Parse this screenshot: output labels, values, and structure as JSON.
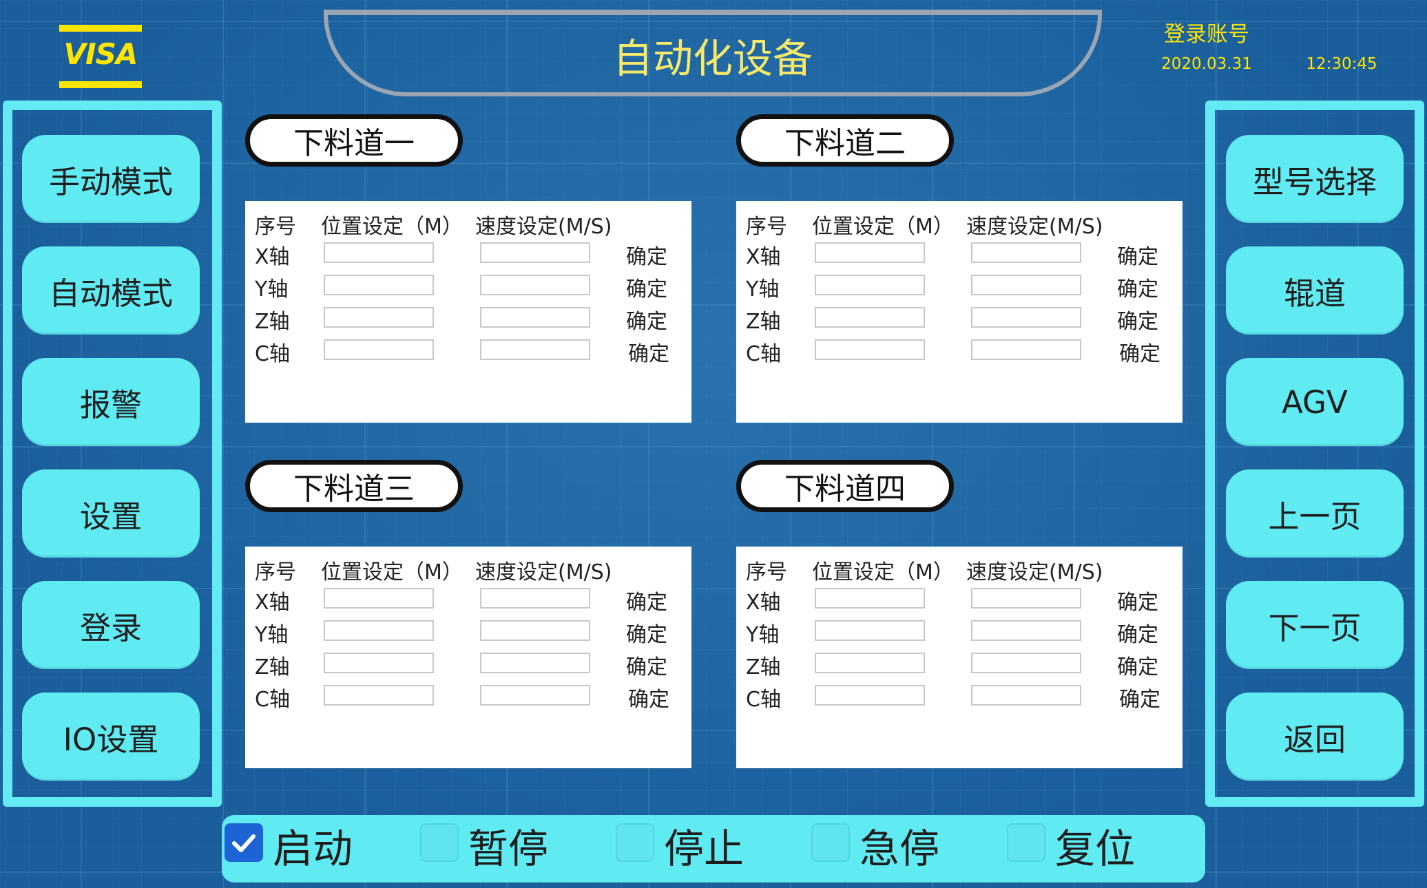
{
  "header": {
    "logo_text": "VISA",
    "title": "自动化设备",
    "account": "登录账号",
    "date": "2020.03.31",
    "time": "12:30:45"
  },
  "left_menu": [
    "手动模式",
    "自动模式",
    "报警",
    "设置",
    "登录",
    "IO设置"
  ],
  "right_menu": [
    "型号选择",
    "辊道",
    "AGV",
    "上一页",
    "下一页",
    "返回"
  ],
  "lanes": [
    {
      "name": "下料道一",
      "rows": [
        {
          "axis": "X轴",
          "position": "",
          "speed": "",
          "confirm": "确定"
        },
        {
          "axis": "Y轴",
          "position": "",
          "speed": "",
          "confirm": "确定"
        },
        {
          "axis": "Z轴",
          "position": "",
          "speed": "",
          "confirm": "确定"
        },
        {
          "axis": "C轴",
          "position": "",
          "speed": "",
          "confirm": "确定"
        }
      ]
    },
    {
      "name": "下料道二",
      "rows": [
        {
          "axis": "X轴",
          "position": "",
          "speed": "",
          "confirm": "确定"
        },
        {
          "axis": "Y轴",
          "position": "",
          "speed": "",
          "confirm": "确定"
        },
        {
          "axis": "Z轴",
          "position": "",
          "speed": "",
          "confirm": "确定"
        },
        {
          "axis": "C轴",
          "position": "",
          "speed": "",
          "confirm": "确定"
        }
      ]
    },
    {
      "name": "下料道三",
      "rows": [
        {
          "axis": "X轴",
          "position": "",
          "speed": "",
          "confirm": "确定"
        },
        {
          "axis": "Y轴",
          "position": "",
          "speed": "",
          "confirm": "确定"
        },
        {
          "axis": "Z轴",
          "position": "",
          "speed": "",
          "confirm": "确定"
        },
        {
          "axis": "C轴",
          "position": "",
          "speed": "",
          "confirm": "确定"
        }
      ]
    },
    {
      "name": "下料道四",
      "rows": [
        {
          "axis": "X轴",
          "position": "",
          "speed": "",
          "confirm": "确定"
        },
        {
          "axis": "Y轴",
          "position": "",
          "speed": "",
          "confirm": "确定"
        },
        {
          "axis": "Z轴",
          "position": "",
          "speed": "",
          "confirm": "确定"
        },
        {
          "axis": "C轴",
          "position": "",
          "speed": "",
          "confirm": "确定"
        }
      ]
    }
  ],
  "table_headers": {
    "index": "序号",
    "position": "位置设定（M）",
    "speed": "速度设定(M/S)"
  },
  "controls": [
    {
      "label": "启动",
      "checked": true
    },
    {
      "label": "暂停",
      "checked": false
    },
    {
      "label": "停止",
      "checked": false
    },
    {
      "label": "急停",
      "checked": false
    },
    {
      "label": "复位",
      "checked": false
    }
  ],
  "colors": {
    "accent": "#60eaf2",
    "background": "#1a5f9c",
    "highlight": "#ffe600",
    "checked": "#1e63d6"
  }
}
